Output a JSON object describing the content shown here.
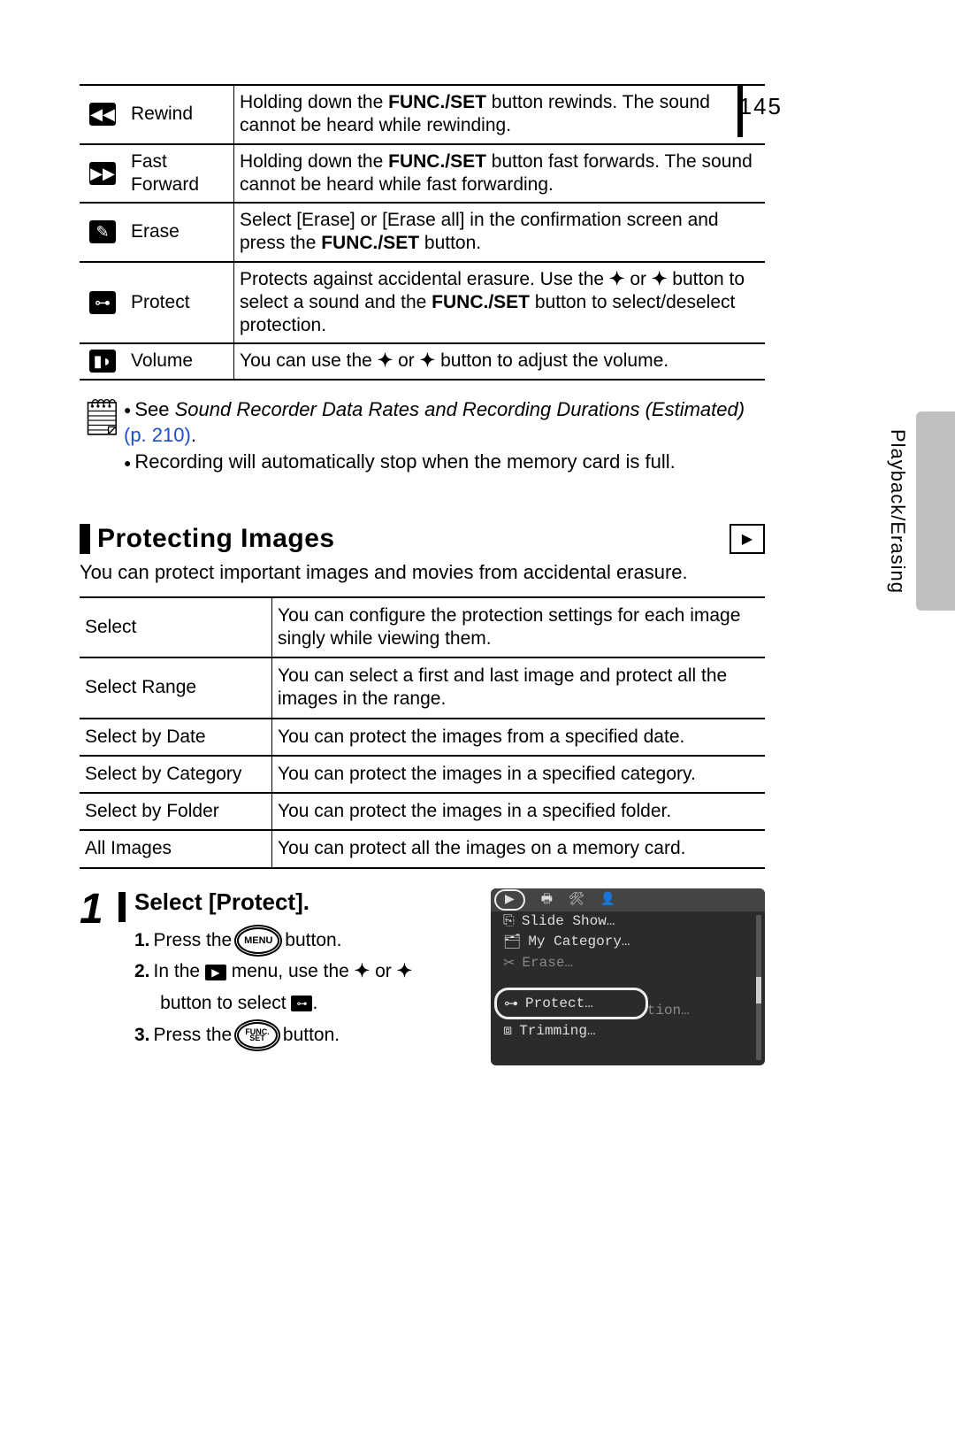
{
  "page_number": "145",
  "side_label": "Playback/Erasing",
  "func_table": [
    {
      "icon": "◀◀",
      "name": "Rewind",
      "desc_pre": "Holding down the ",
      "bold": "FUNC./SET",
      "desc_post": " button rewinds. The sound cannot be heard while rewinding."
    },
    {
      "icon": "▶▶",
      "name": "Fast Forward",
      "desc_pre": "Holding down the ",
      "bold": "FUNC./SET",
      "desc_post": " button fast forwards. The sound cannot be heard while fast forwarding."
    },
    {
      "icon": "✎",
      "name": "Erase",
      "desc_pre": "Select [Erase] or [Erase all] in the confirmation screen and press the ",
      "bold": "FUNC./SET",
      "desc_post": " button."
    },
    {
      "icon": "⊶",
      "name": "Protect",
      "desc_full": "Protects against accidental erasure. Use the ✦ or ✦ button to select a sound and the FUNC./SET button to select/deselect protection."
    },
    {
      "icon": "▮◗",
      "name": "Volume",
      "desc_full": "You can use the ✦ or ✦ button to adjust the volume."
    }
  ],
  "note": {
    "line1_a": "See ",
    "line1_italic": "Sound Recorder Data Rates and Recording Durations (Estimated)",
    "line1_link": " (p. 210)",
    "line1_b": ".",
    "line2": "Recording will automatically stop when the memory card is full."
  },
  "section_title": "Protecting Images",
  "section_intro": "You can protect important images and movies from accidental erasure.",
  "opts_table": [
    {
      "label": "Select",
      "desc": "You can configure the protection settings for each image singly while viewing them."
    },
    {
      "label": "Select Range",
      "desc": "You can select a first and last image and protect all the images in the range."
    },
    {
      "label": "Select by Date",
      "desc": "You can protect the images from a specified date."
    },
    {
      "label": "Select by Category",
      "desc": "You can protect the images in a specified category."
    },
    {
      "label": "Select by Folder",
      "desc": "You can protect the images in a specified folder."
    },
    {
      "label": "All Images",
      "desc": "You can protect all the images on a memory card."
    }
  ],
  "step": {
    "num": "1",
    "title": "Select [Protect].",
    "line1_a": "Press the ",
    "menu_label": "MENU",
    "line1_b": " button.",
    "line2_a": "In the ",
    "line2_b": " menu, use the ",
    "line2_c": " or ",
    "line2_d": " button to select ",
    "line2_e": ".",
    "line3_a": "Press the ",
    "func_top": "FUNC.",
    "func_bot": "SET",
    "line3_b": " button."
  },
  "cam_menu": {
    "items": [
      "Slide Show…",
      "My Category…",
      "Erase…",
      "Protect…",
      "Red-Eye Correction…",
      "Trimming…"
    ]
  }
}
